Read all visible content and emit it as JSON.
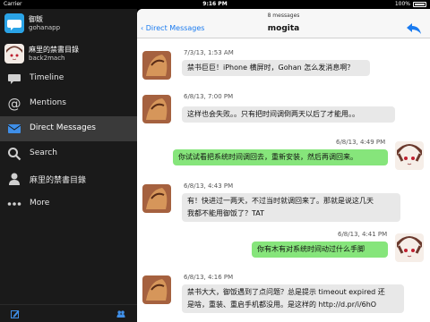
{
  "status": {
    "carrier": "Carrier",
    "time": "9:16 PM",
    "battery": "100%"
  },
  "accounts": [
    {
      "name": "御飯",
      "screen_name": "gohanapp"
    },
    {
      "name": "麻里的禁書目錄",
      "screen_name": "back2mach"
    }
  ],
  "menu": [
    {
      "label": "Timeline",
      "icon": "speech-bubble-icon"
    },
    {
      "label": "Mentions",
      "icon": "at-icon"
    },
    {
      "label": "Direct Messages",
      "icon": "envelope-icon"
    },
    {
      "label": "Search",
      "icon": "search-icon"
    },
    {
      "label": "麻里的禁書目錄",
      "icon": "person-icon"
    },
    {
      "label": "More",
      "icon": "more-dots-icon"
    }
  ],
  "footer": {
    "compose_icon": "compose-icon",
    "users_icon": "users-icon"
  },
  "conversation": {
    "count": "8 messages",
    "back_label": "Direct Messages",
    "title": "mogita",
    "reply_icon": "reply-icon"
  },
  "messages": [
    {
      "time": "7/3/13, 1:53 AM",
      "lines": [
        "禁书巨巨！iPhone 横屏时，Gohan 怎么发消息啊？"
      ],
      "direction": "in"
    },
    {
      "time": "6/8/13, 7:00 PM",
      "lines": [
        "这样也会失败。。只有把时间调倒两天以后了才能用。。"
      ],
      "direction": "in"
    },
    {
      "time": "6/8/13, 4:49 PM",
      "lines": [
        "你试试看把系统时间调回去，重新安装，然后再调回来。"
      ],
      "direction": "out"
    },
    {
      "time": "6/8/13, 4:43 PM",
      "lines": [
        "有！快进过一两天，不过当时就调回来了。那就是说这几天",
        "我都不能用御饭了？TAT"
      ],
      "direction": "in"
    },
    {
      "time": "6/8/13, 4:41 PM",
      "lines": [
        "你有木有对系统时间动过什么手脚"
      ],
      "direction": "out"
    },
    {
      "time": "6/8/13, 4:16 PM",
      "lines": [
        "禁书大大，御饭遇到了点问题？总是提示 timeout expired 还",
        "是啥，重装、重启手机都没用。是这样的 http://d.pr/i/6hO"
      ],
      "direction": "in"
    }
  ]
}
